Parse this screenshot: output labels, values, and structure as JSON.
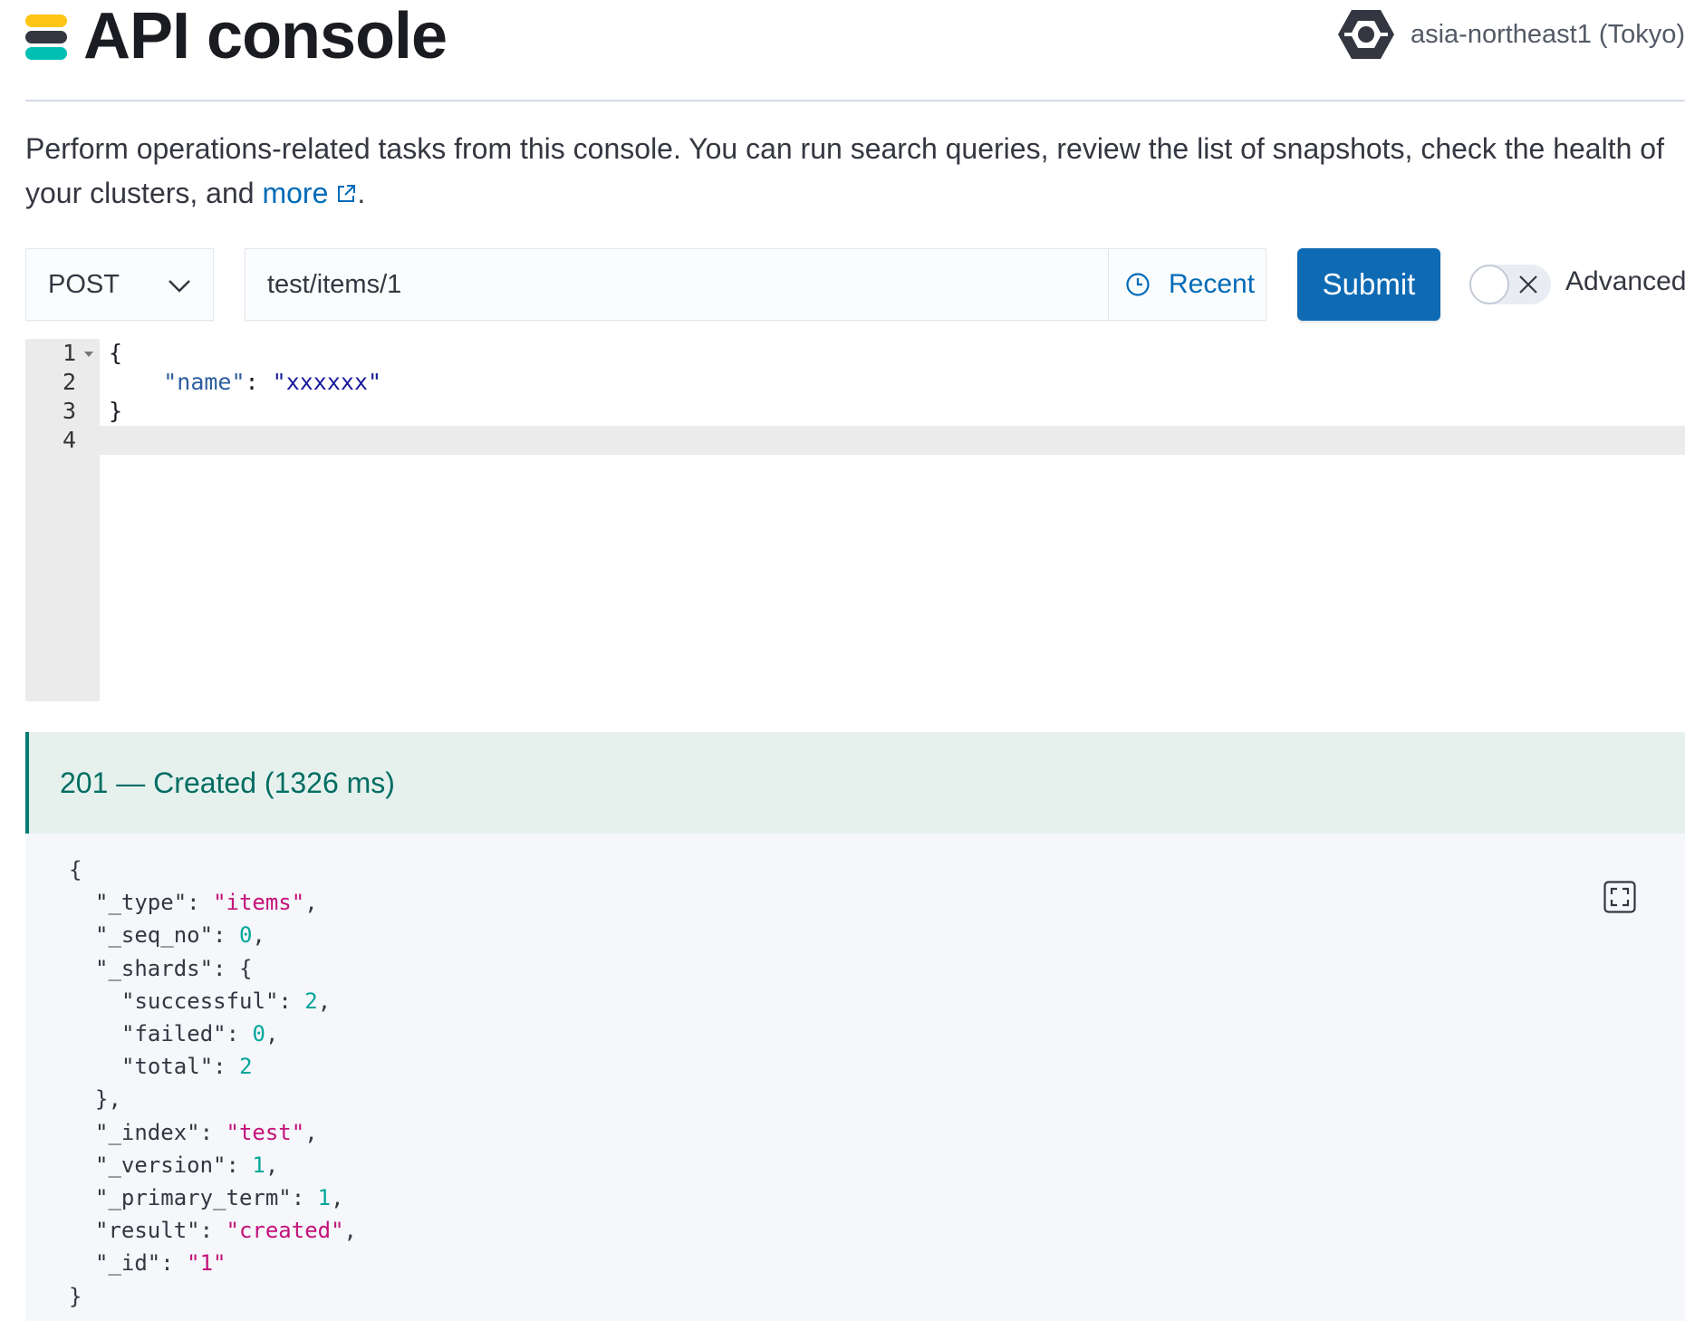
{
  "header": {
    "title": "API console",
    "region_icon": "hexagon-cloud-icon",
    "region_label": "asia-northeast1 (Tokyo)",
    "logo_colors": [
      "#fec514",
      "#343741",
      "#00bfb3"
    ]
  },
  "description": {
    "text": "Perform operations-related tasks from this console. You can run search queries, review the list of snapshots, check the health of your clusters, and ",
    "link_label": "more",
    "trailing": "."
  },
  "request": {
    "method": "POST",
    "path": "test/items/1",
    "recent_label": "Recent",
    "submit_label": "Submit",
    "advanced_label": "Advanced",
    "advanced_enabled": false
  },
  "editor": {
    "line_numbers": [
      "1",
      "2",
      "3",
      "4"
    ],
    "lines": [
      {
        "text": "{"
      },
      {
        "indent": "    ",
        "key": "\"name\"",
        "sep": ": ",
        "value": "\"xxxxxx\""
      },
      {
        "text": "}"
      },
      {
        "text": ""
      }
    ]
  },
  "response": {
    "status": "201 — Created (1326 ms)",
    "colors": {
      "accent": "#017d73",
      "submit": "#0f6ab4",
      "link": "#006bb8"
    },
    "lines": [
      {
        "indent": "",
        "parts": [
          {
            "t": "p",
            "v": "{"
          }
        ]
      },
      {
        "indent": "  ",
        "parts": [
          {
            "t": "k",
            "v": "\"_type\""
          },
          {
            "t": "p",
            "v": ": "
          },
          {
            "t": "s",
            "v": "\"items\""
          },
          {
            "t": "p",
            "v": ","
          }
        ]
      },
      {
        "indent": "  ",
        "parts": [
          {
            "t": "k",
            "v": "\"_seq_no\""
          },
          {
            "t": "p",
            "v": ": "
          },
          {
            "t": "n",
            "v": "0"
          },
          {
            "t": "p",
            "v": ","
          }
        ]
      },
      {
        "indent": "  ",
        "parts": [
          {
            "t": "k",
            "v": "\"_shards\""
          },
          {
            "t": "p",
            "v": ": {"
          }
        ]
      },
      {
        "indent": "    ",
        "parts": [
          {
            "t": "k",
            "v": "\"successful\""
          },
          {
            "t": "p",
            "v": ": "
          },
          {
            "t": "n",
            "v": "2"
          },
          {
            "t": "p",
            "v": ","
          }
        ]
      },
      {
        "indent": "    ",
        "parts": [
          {
            "t": "k",
            "v": "\"failed\""
          },
          {
            "t": "p",
            "v": ": "
          },
          {
            "t": "n",
            "v": "0"
          },
          {
            "t": "p",
            "v": ","
          }
        ]
      },
      {
        "indent": "    ",
        "parts": [
          {
            "t": "k",
            "v": "\"total\""
          },
          {
            "t": "p",
            "v": ": "
          },
          {
            "t": "n",
            "v": "2"
          }
        ]
      },
      {
        "indent": "  ",
        "parts": [
          {
            "t": "p",
            "v": "},"
          }
        ]
      },
      {
        "indent": "  ",
        "parts": [
          {
            "t": "k",
            "v": "\"_index\""
          },
          {
            "t": "p",
            "v": ": "
          },
          {
            "t": "s",
            "v": "\"test\""
          },
          {
            "t": "p",
            "v": ","
          }
        ]
      },
      {
        "indent": "  ",
        "parts": [
          {
            "t": "k",
            "v": "\"_version\""
          },
          {
            "t": "p",
            "v": ": "
          },
          {
            "t": "n",
            "v": "1"
          },
          {
            "t": "p",
            "v": ","
          }
        ]
      },
      {
        "indent": "  ",
        "parts": [
          {
            "t": "k",
            "v": "\"_primary_term\""
          },
          {
            "t": "p",
            "v": ": "
          },
          {
            "t": "n",
            "v": "1"
          },
          {
            "t": "p",
            "v": ","
          }
        ]
      },
      {
        "indent": "  ",
        "parts": [
          {
            "t": "k",
            "v": "\"result\""
          },
          {
            "t": "p",
            "v": ": "
          },
          {
            "t": "s",
            "v": "\"created\""
          },
          {
            "t": "p",
            "v": ","
          }
        ]
      },
      {
        "indent": "  ",
        "parts": [
          {
            "t": "k",
            "v": "\"_id\""
          },
          {
            "t": "p",
            "v": ": "
          },
          {
            "t": "s",
            "v": "\"1\""
          }
        ]
      },
      {
        "indent": "",
        "parts": [
          {
            "t": "p",
            "v": "}"
          }
        ]
      }
    ]
  }
}
